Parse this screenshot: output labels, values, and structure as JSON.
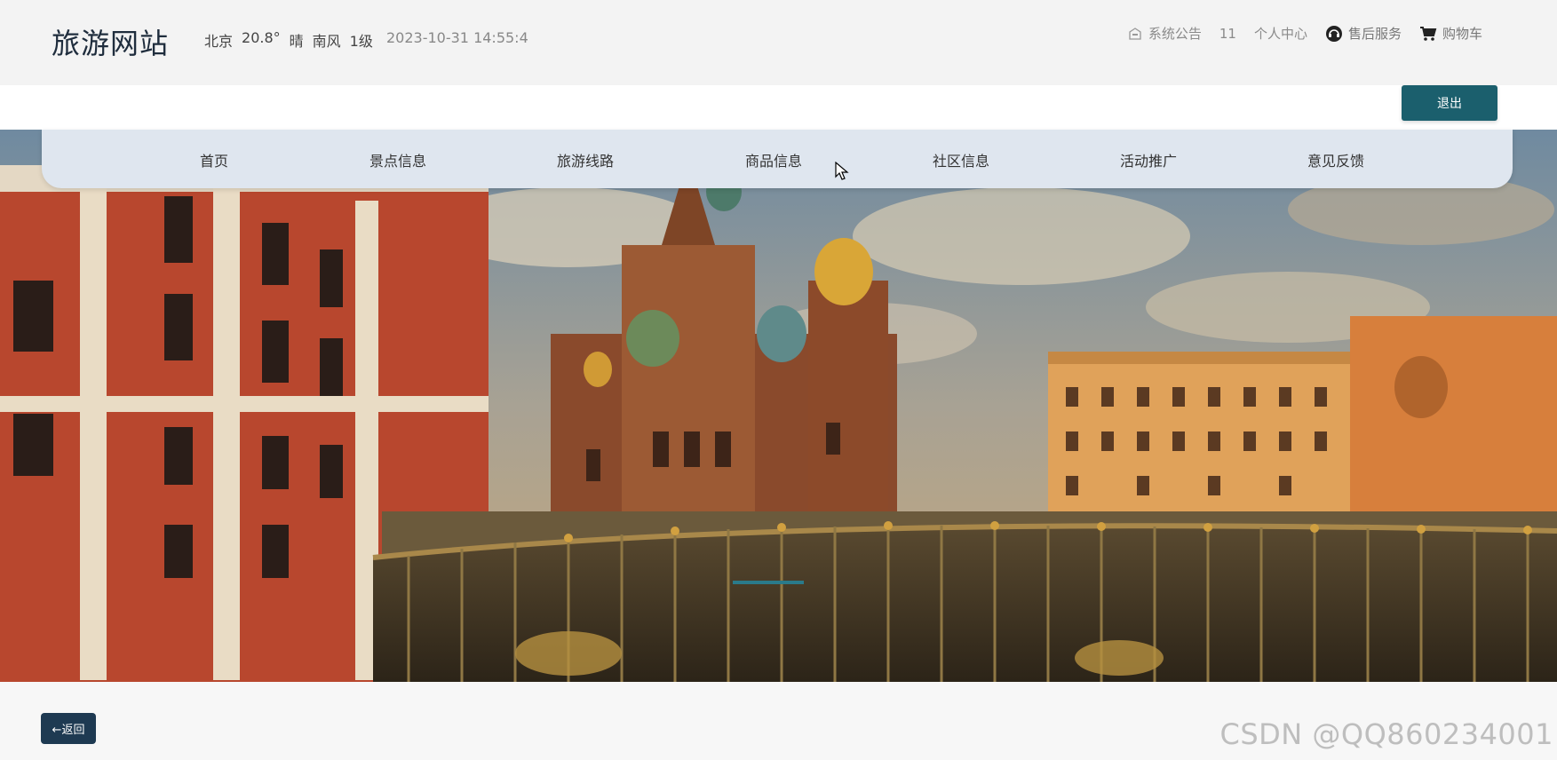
{
  "header": {
    "site_title": "旅游网站",
    "weather": {
      "city": "北京",
      "temp": "20.8°",
      "condition": "晴",
      "wind": "南风",
      "level": "1级"
    },
    "datetime": "2023-10-31 14:55:4",
    "links": {
      "announcement": "系统公告",
      "count": "11",
      "profile": "个人中心",
      "service": "售后服务",
      "cart": "购物车"
    }
  },
  "toolbar": {
    "logout_label": "退出"
  },
  "nav": {
    "items": [
      "首页",
      "景点信息",
      "旅游线路",
      "商品信息",
      "社区信息",
      "活动推广",
      "意见反馈"
    ]
  },
  "footer": {
    "back_label": "←返回",
    "watermark": "CSDN @QQ860234001"
  },
  "colors": {
    "logout": "#1b5f6d",
    "back": "#1e3a52",
    "nav_bg": "#dfe6ef"
  },
  "icons": {
    "announcement": "building-icon",
    "service": "headset-icon",
    "cart": "cart-icon"
  }
}
